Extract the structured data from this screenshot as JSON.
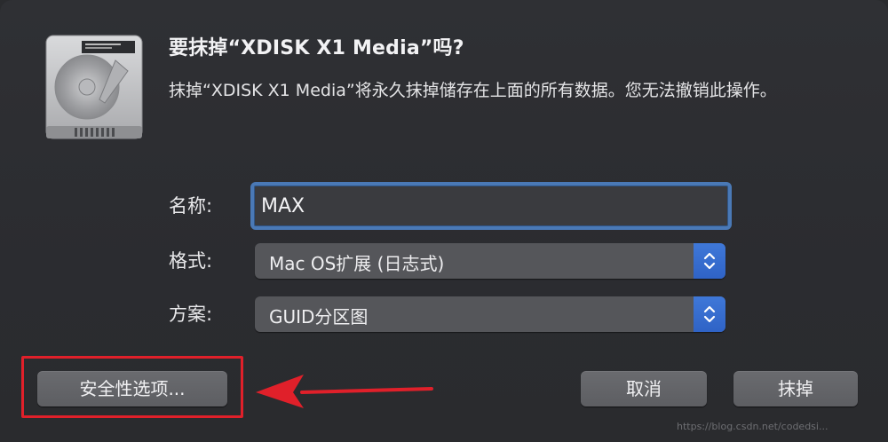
{
  "dialog": {
    "title": "要抹掉“XDISK X1 Media”吗?",
    "message": "抹掉“XDISK X1 Media”将永久抹掉储存在上面的所有数据。您无法撤销此操作。",
    "icon": "hard-disk-icon"
  },
  "form": {
    "name_label": "名称:",
    "name_value": "MAX",
    "format_label": "格式:",
    "format_value": "Mac OS扩展 (日志式)",
    "scheme_label": "方案:",
    "scheme_value": "GUID分区图"
  },
  "buttons": {
    "security_options": "安全性选项...",
    "cancel": "取消",
    "erase": "抹掉"
  },
  "annotation": {
    "highlight_color": "#e0202a"
  },
  "watermark": "https://blog.csdn.net/codedsi..."
}
